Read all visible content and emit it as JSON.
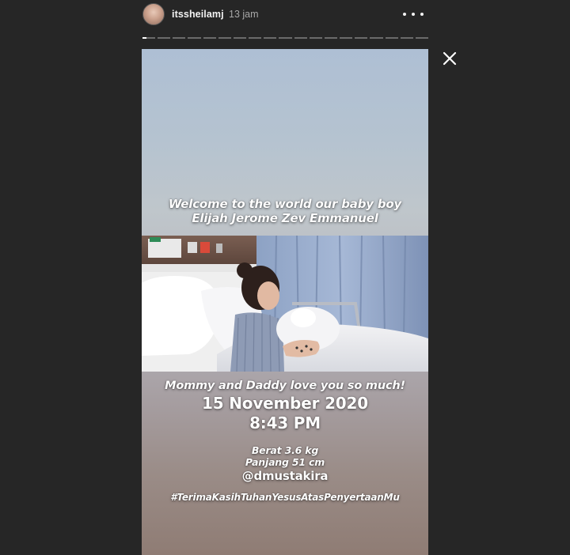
{
  "header": {
    "avatar_icon": "profile-avatar",
    "username": "itssheilamj",
    "timestamp": "13 jam",
    "more_icon": "more-horizontal-icon"
  },
  "progress": {
    "segments": 19,
    "current_index": 0,
    "current_progress": 0.3,
    "active_color": "#ffffff",
    "inactive_color": "#6a6a6a"
  },
  "close_icon": "close-icon",
  "story": {
    "welcome_line1": "Welcome to the world our baby boy",
    "welcome_line2": "Elijah Jerome Zev Emmanuel",
    "photo_icon": "hospital-photo",
    "love_text": "Mommy and Daddy love you so much!",
    "date": "15 November 2020",
    "time": "8:43 PM",
    "weight": "Berat 3.6 kg",
    "length": "Panjang 51 cm",
    "handle": "@dmustakira",
    "hashtag": "#TerimaKasihTuhanYesusAtasPenyertaanMu"
  },
  "colors": {
    "background": "#262626",
    "text": "#f2f2f2",
    "muted": "#a8a8a8"
  }
}
